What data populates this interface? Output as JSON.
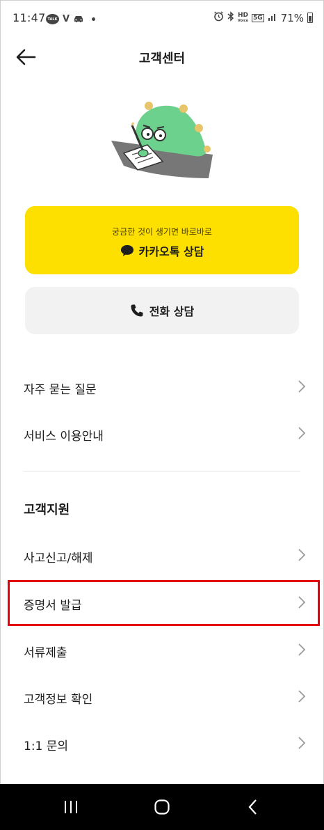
{
  "status_bar": {
    "time": "11:47",
    "talk_badge": "TALK",
    "battery_percent": "71%",
    "hd_label": "HD",
    "voice_label": "Voice",
    "network_label": "5G",
    "icons": [
      "talk-icon",
      "vpn-icon",
      "car-icon",
      "alarm-icon",
      "bluetooth-icon",
      "signal-icon",
      "battery-icon"
    ]
  },
  "header": {
    "title": "고객센터",
    "back_icon": "arrow-left-icon"
  },
  "consult": {
    "kakao_subtitle": "궁금한 것이 생기면 바로바로",
    "kakao_label": "카카오톡 상담",
    "kakao_icon": "speech-bubble-icon",
    "phone_label": "전화 상담",
    "phone_icon": "phone-icon",
    "kakao_color": "#fee000"
  },
  "menu": {
    "top_items": [
      {
        "label": "자주 묻는 질문"
      },
      {
        "label": "서비스 이용안내"
      }
    ],
    "section_title": "고객지원",
    "support_items": [
      {
        "label": "사고신고/해제"
      },
      {
        "label": "증명서 발급",
        "highlighted": true
      },
      {
        "label": "서류제출"
      },
      {
        "label": "고객정보 확인"
      },
      {
        "label": "1:1 문의"
      }
    ],
    "highlight_color": "#e3000f"
  },
  "nav_bar": {
    "buttons": [
      "recent-apps-icon",
      "home-icon",
      "back-icon"
    ]
  }
}
